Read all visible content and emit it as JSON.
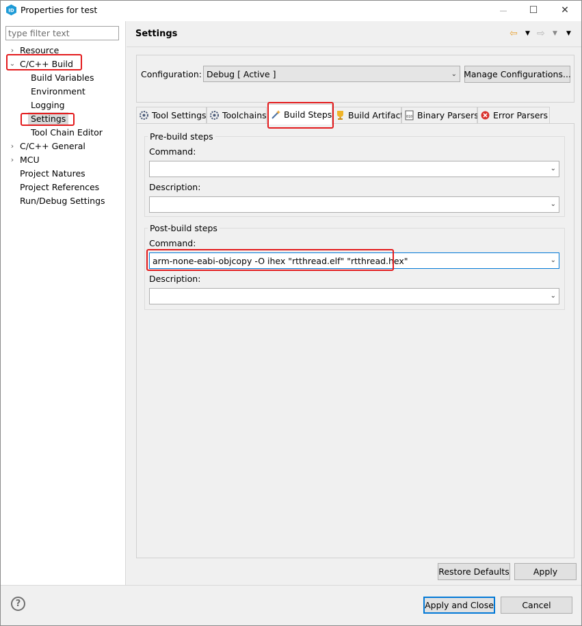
{
  "window": {
    "title": "Properties for test",
    "controls": {
      "minimize": "—",
      "maximize": "☐",
      "close": "✕"
    }
  },
  "filter": {
    "placeholder": "type filter text"
  },
  "tree": {
    "resource": "Resource",
    "cpp_build": "C/C++ Build",
    "build_variables": "Build Variables",
    "environment": "Environment",
    "logging": "Logging",
    "settings": "Settings",
    "tool_chain_editor": "Tool Chain Editor",
    "cpp_general": "C/C++ General",
    "mcu": "MCU",
    "project_natures": "Project Natures",
    "project_references": "Project References",
    "run_debug_settings": "Run/Debug Settings"
  },
  "page": {
    "title": "Settings"
  },
  "configuration": {
    "label": "Configuration:",
    "value": "Debug  [ Active ]",
    "manage_button": "Manage Configurations..."
  },
  "tabs": {
    "tool_settings": "Tool Settings",
    "toolchains": "Toolchains",
    "build_steps": "Build Steps",
    "build_artifact": "Build Artifact",
    "binary_parsers": "Binary Parsers",
    "error_parsers": "Error Parsers"
  },
  "pre_build": {
    "group_title": "Pre-build steps",
    "command_label": "Command:",
    "command_value": "",
    "description_label": "Description:",
    "description_value": ""
  },
  "post_build": {
    "group_title": "Post-build steps",
    "command_label": "Command:",
    "command_value": "arm-none-eabi-objcopy -O ihex \"rtthread.elf\" \"rtthread.hex\"",
    "description_label": "Description:",
    "description_value": ""
  },
  "buttons": {
    "restore_defaults": "Restore Defaults",
    "apply": "Apply",
    "apply_and_close": "Apply and Close",
    "cancel": "Cancel",
    "help": "?"
  },
  "colors": {
    "highlight": "#e3191b",
    "accent": "#0078d7"
  }
}
